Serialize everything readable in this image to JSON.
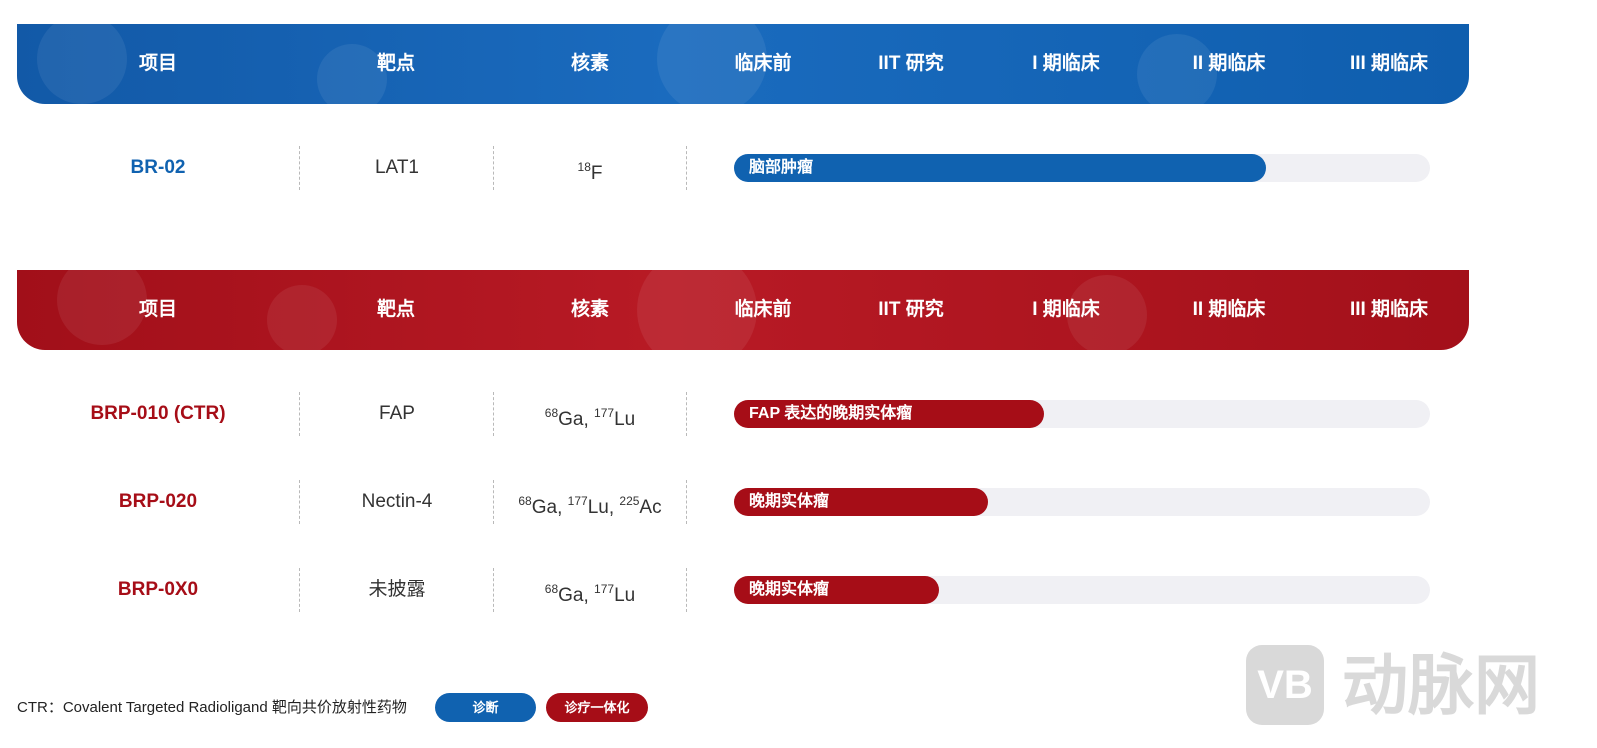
{
  "colors": {
    "blue": "#1062b0",
    "red": "#a60d17",
    "track": "#f0f0f4",
    "watermark": "#d9d9d9"
  },
  "headers": {
    "project": "项目",
    "target": "靶点",
    "nuclide": "核素",
    "preclinical": "临床前",
    "iit": "IIT 研究",
    "phase1": "I 期临床",
    "phase2": "II 期临床",
    "phase3": "III 期临床"
  },
  "diagnostic": {
    "rows": [
      {
        "project": "BR-02",
        "target": "LAT1",
        "nuclides": [
          {
            "mass": "18",
            "symbol": "F"
          }
        ],
        "indication": "脑部肿瘤",
        "progress": 0.765
      }
    ]
  },
  "theranostic": {
    "rows": [
      {
        "project": "BRP-010 (CTR)",
        "target": "FAP",
        "nuclides": [
          {
            "mass": "68",
            "symbol": "Ga"
          },
          {
            "mass": "177",
            "symbol": "Lu"
          }
        ],
        "indication": "FAP 表达的晚期实体瘤",
        "progress": 0.445
      },
      {
        "project": "BRP-020",
        "target": "Nectin-4",
        "nuclides": [
          {
            "mass": "68",
            "symbol": "Ga"
          },
          {
            "mass": "177",
            "symbol": "Lu"
          },
          {
            "mass": "225",
            "symbol": "Ac"
          }
        ],
        "indication": "晚期实体瘤",
        "progress": 0.365
      },
      {
        "project": "BRP-0X0",
        "target": "未披露",
        "nuclides": [
          {
            "mass": "68",
            "symbol": "Ga"
          },
          {
            "mass": "177",
            "symbol": "Lu"
          }
        ],
        "indication": "晚期实体瘤",
        "progress": 0.295
      }
    ]
  },
  "legend": {
    "note": "CTR：Covalent Targeted Radioligand 靶向共价放射性药物",
    "diagnostic_label": "诊断",
    "theranostic_label": "诊疗一体化"
  },
  "watermark": {
    "logo": "VB",
    "text": "动脉网"
  }
}
